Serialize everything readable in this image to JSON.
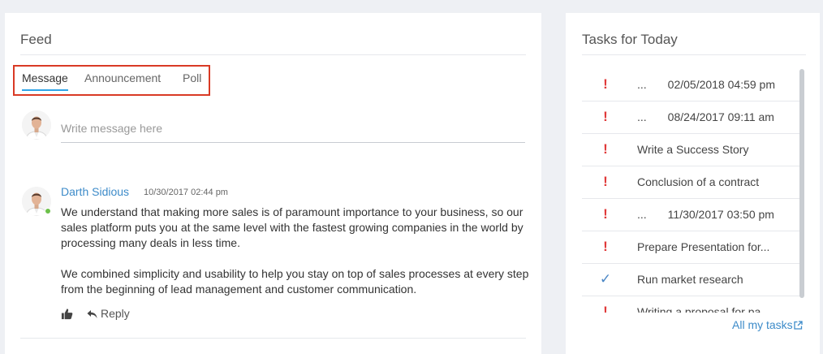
{
  "feed": {
    "title": "Feed",
    "tabs": [
      {
        "label": "Message",
        "active": true
      },
      {
        "label": "Announcement",
        "active": false
      },
      {
        "label": "Poll",
        "active": false
      }
    ],
    "compose": {
      "placeholder": "Write message here"
    },
    "post": {
      "author": "Darth Sidious",
      "time": "10/30/2017 02:44 pm",
      "paragraphs": [
        "We understand that making more sales is of paramount importance to your business, so our sales platform puts you at the same level with the fastest growing companies in the world by processing many deals in less time.",
        "We combined simplicity and usability to help you stay on top of sales processes at every step from the beginning of lead management and customer communication."
      ],
      "reply_label": "Reply",
      "like_icon": "thumbs-up-icon",
      "online_color": "#6cc04a"
    }
  },
  "tasks": {
    "title": "Tasks for Today",
    "items": [
      {
        "status": "!",
        "text": "...",
        "date": "02/05/2018 04:59 pm"
      },
      {
        "status": "!",
        "text": "...",
        "date": "08/24/2017 09:11 am"
      },
      {
        "status": "!",
        "text": "Write a Success Story",
        "date": ""
      },
      {
        "status": "!",
        "text": "Conclusion of a contract",
        "date": ""
      },
      {
        "status": "!",
        "text": "...",
        "date": "11/30/2017 03:50 pm"
      },
      {
        "status": "!",
        "text": "Prepare Presentation for...",
        "date": ""
      },
      {
        "status": "✓",
        "text": "Run market research",
        "date": ""
      },
      {
        "status": "!",
        "text": "Writing a proposal for pa",
        "date": ""
      }
    ],
    "all_tasks_label": "All my tasks",
    "accent_color": "#3d8bc9",
    "urgent_color": "#e03a3a"
  }
}
